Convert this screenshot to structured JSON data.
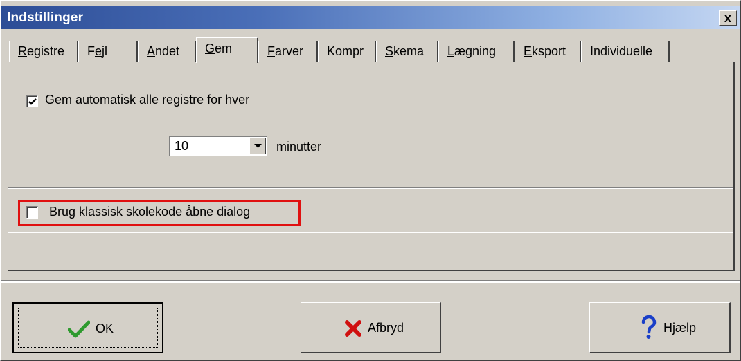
{
  "window": {
    "title": "Indstillinger",
    "close_glyph": "x"
  },
  "tabs": [
    {
      "pre": "",
      "key": "R",
      "post": "egistre"
    },
    {
      "pre": "F",
      "key": "e",
      "post": "jl"
    },
    {
      "pre": "",
      "key": "A",
      "post": "ndet"
    },
    {
      "pre": "",
      "key": "G",
      "post": "em",
      "active": true
    },
    {
      "pre": "",
      "key": "F",
      "post": "arver"
    },
    {
      "pre": "",
      "key": "",
      "post": "Kompr"
    },
    {
      "pre": "",
      "key": "S",
      "post": "kema"
    },
    {
      "pre": "",
      "key": "L",
      "post": "ægning"
    },
    {
      "pre": "",
      "key": "E",
      "post": "ksport"
    },
    {
      "pre": "",
      "key": "",
      "post": "Individuelle"
    }
  ],
  "autosave": {
    "checked": true,
    "label": "Gem automatisk alle registre for hver",
    "interval_value": "10",
    "unit": "minutter"
  },
  "classic_dialog": {
    "checked": false,
    "label": "Brug klassisk skolekode åbne dialog"
  },
  "buttons": {
    "ok": "OK",
    "cancel": "Afbryd",
    "help_pre": "",
    "help_key": "H",
    "help_post": "jælp"
  },
  "colors": {
    "highlight": "#e01010",
    "ok_check": "#2e9a2e",
    "cancel_x": "#d01010",
    "help_q": "#1a3fc8"
  },
  "icons": {
    "ok": "green-check-icon",
    "cancel": "red-x-icon",
    "help": "blue-question-icon"
  }
}
